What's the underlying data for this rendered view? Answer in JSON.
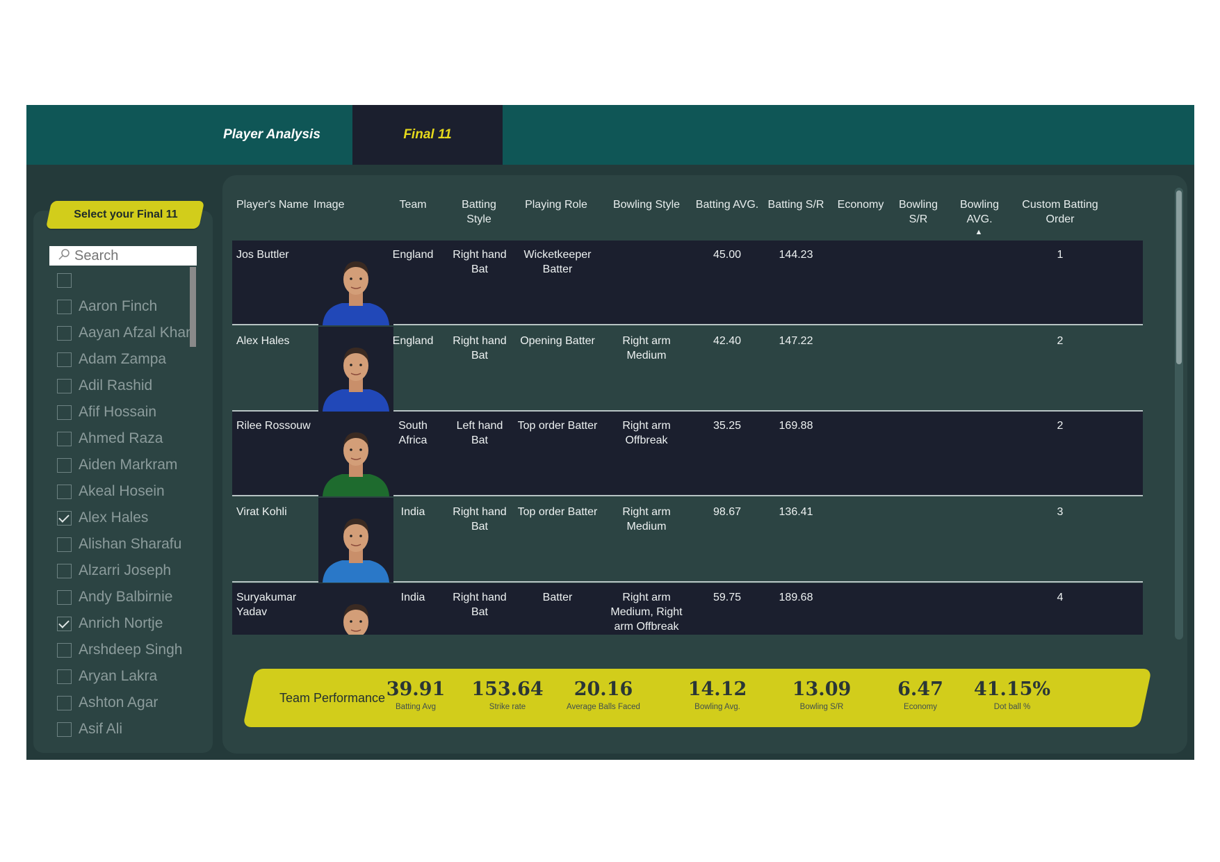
{
  "tabs": [
    {
      "label": "Player Analysis"
    },
    {
      "label": "Final 11"
    }
  ],
  "sidebar": {
    "select_label": "Select your Final 11",
    "search_placeholder": "Search",
    "players": [
      {
        "name": "",
        "checked": false
      },
      {
        "name": "Aaron Finch",
        "checked": false
      },
      {
        "name": "Aayan Afzal Khan",
        "checked": false
      },
      {
        "name": "Adam Zampa",
        "checked": false
      },
      {
        "name": "Adil Rashid",
        "checked": false
      },
      {
        "name": "Afif Hossain",
        "checked": false
      },
      {
        "name": "Ahmed Raza",
        "checked": false
      },
      {
        "name": "Aiden Markram",
        "checked": false
      },
      {
        "name": "Akeal Hosein",
        "checked": false
      },
      {
        "name": "Alex Hales",
        "checked": true
      },
      {
        "name": "Alishan Sharafu",
        "checked": false
      },
      {
        "name": "Alzarri Joseph",
        "checked": false
      },
      {
        "name": "Andy Balbirnie",
        "checked": false
      },
      {
        "name": "Anrich Nortje",
        "checked": true
      },
      {
        "name": "Arshdeep Singh",
        "checked": false
      },
      {
        "name": "Aryan Lakra",
        "checked": false
      },
      {
        "name": "Ashton Agar",
        "checked": false
      },
      {
        "name": "Asif Ali",
        "checked": false
      }
    ]
  },
  "table": {
    "columns": [
      "Player's Name",
      "Image",
      "Team",
      "Batting Style",
      "Playing Role",
      "Bowling Style",
      "Batting AVG.",
      "Batting S/R",
      "Economy",
      "Bowling S/R",
      "Bowling AVG.",
      "Custom Batting Order"
    ],
    "sort_indicator": "▲",
    "rows": [
      {
        "name": "Jos Buttler",
        "team": "England",
        "batting_style": "Right hand Bat",
        "playing_role": "Wicketkeeper Batter",
        "bowling_style": "",
        "batting_avg": "45.00",
        "batting_sr": "144.23",
        "economy": "",
        "bowling_sr": "",
        "bowling_avg": "",
        "order": "1",
        "jersey": "#2148b8"
      },
      {
        "name": "Alex Hales",
        "team": "England",
        "batting_style": "Right hand Bat",
        "playing_role": "Opening Batter",
        "bowling_style": "Right arm Medium",
        "batting_avg": "42.40",
        "batting_sr": "147.22",
        "economy": "",
        "bowling_sr": "",
        "bowling_avg": "",
        "order": "2",
        "jersey": "#2148b8"
      },
      {
        "name": "Rilee Rossouw",
        "team": "South Africa",
        "batting_style": "Left hand Bat",
        "playing_role": "Top order Batter",
        "bowling_style": "Right arm Offbreak",
        "batting_avg": "35.25",
        "batting_sr": "169.88",
        "economy": "",
        "bowling_sr": "",
        "bowling_avg": "",
        "order": "2",
        "jersey": "#1e6b2e"
      },
      {
        "name": "Virat Kohli",
        "team": "India",
        "batting_style": "Right hand Bat",
        "playing_role": "Top order Batter",
        "bowling_style": "Right arm Medium",
        "batting_avg": "98.67",
        "batting_sr": "136.41",
        "economy": "",
        "bowling_sr": "",
        "bowling_avg": "",
        "order": "3",
        "jersey": "#2a78c8"
      },
      {
        "name": "Suryakumar Yadav",
        "team": "India",
        "batting_style": "Right hand Bat",
        "playing_role": "Batter",
        "bowling_style": "Right arm Medium, Right arm Offbreak",
        "batting_avg": "59.75",
        "batting_sr": "189.68",
        "economy": "",
        "bowling_sr": "",
        "bowling_avg": "",
        "order": "4",
        "jersey": "#2a58b8"
      }
    ]
  },
  "team_performance": {
    "label": "Team Performance",
    "kpis": [
      {
        "value": "39.91",
        "label": "Batting Avg"
      },
      {
        "value": "153.64",
        "label": "Strike rate"
      },
      {
        "value": "20.16",
        "label": "Average Balls Faced"
      },
      {
        "value": "14.12",
        "label": "Bowling Avg."
      },
      {
        "value": "13.09",
        "label": "Bowling S/R"
      },
      {
        "value": "6.47",
        "label": "Economy"
      },
      {
        "value": "41.15%",
        "label": "Dot ball %"
      }
    ]
  },
  "colors": {
    "header": "#0f5656",
    "accent": "#d2cd1b",
    "panel": "#2c4443",
    "row_dark": "#1b1f2e"
  }
}
